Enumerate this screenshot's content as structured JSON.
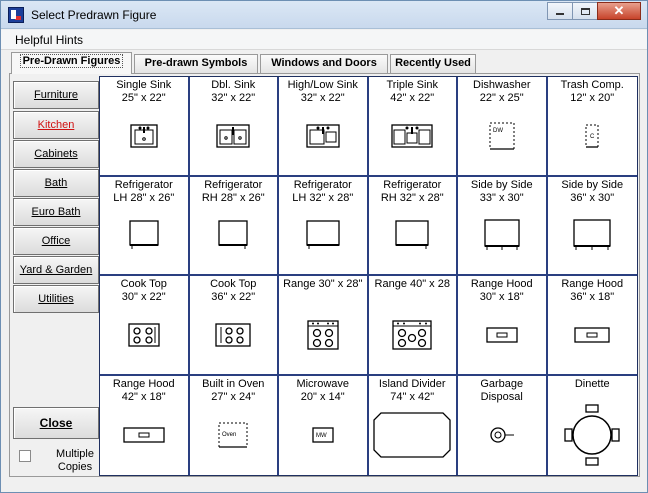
{
  "window": {
    "title": "Select Predrawn Figure",
    "controls": [
      "minimize",
      "maximize",
      "close"
    ]
  },
  "menu": {
    "helpful_hints": "Helpful Hints"
  },
  "tabs": [
    {
      "label": "Pre-Drawn Figures",
      "active": true
    },
    {
      "label": "Pre-drawn Symbols",
      "active": false
    },
    {
      "label": "Windows and Doors",
      "active": false
    },
    {
      "label": "Recently Used",
      "active": false
    }
  ],
  "sidebar": {
    "items": [
      {
        "label": "Furniture",
        "active": false
      },
      {
        "label": "Kitchen",
        "active": true
      },
      {
        "label": "Cabinets",
        "active": false
      },
      {
        "label": "Bath",
        "active": false
      },
      {
        "label": "Euro Bath",
        "active": false
      },
      {
        "label": "Office",
        "active": false
      },
      {
        "label": "Yard & Garden",
        "active": false
      },
      {
        "label": "Utilities",
        "active": false
      }
    ],
    "close_label": "Close",
    "multiple_copies_label": "Multiple Copies",
    "multiple_copies_checked": false
  },
  "figures": [
    {
      "name": "Single Sink",
      "size": "25\" x 22\"",
      "icon": "sink-single-icon"
    },
    {
      "name": "Dbl. Sink",
      "size": "32\" x 22\"",
      "icon": "sink-double-icon"
    },
    {
      "name": "High/Low Sink",
      "size": "32\" x 22\"",
      "icon": "sink-highlow-icon"
    },
    {
      "name": "Triple Sink",
      "size": "42\" x 22\"",
      "icon": "sink-triple-icon"
    },
    {
      "name": "Dishwasher",
      "size": "22\" x 25\"",
      "icon": "dishwasher-icon",
      "icon_text": "DW"
    },
    {
      "name": "Trash Comp.",
      "size": "12\" x 20\"",
      "icon": "trash-compactor-icon",
      "icon_text": "C"
    },
    {
      "name": "Refrigerator",
      "size": "LH 28\" x 26\"",
      "icon": "refrigerator-lh-28-icon"
    },
    {
      "name": "Refrigerator",
      "size": "RH 28\" x 26\"",
      "icon": "refrigerator-rh-28-icon"
    },
    {
      "name": "Refrigerator",
      "size": "LH 32\" x 28\"",
      "icon": "refrigerator-lh-32-icon"
    },
    {
      "name": "Refrigerator",
      "size": "RH 32\" x 28\"",
      "icon": "refrigerator-rh-32-icon"
    },
    {
      "name": "Side by Side",
      "size": "33\" x 30\"",
      "icon": "side-by-side-33-icon"
    },
    {
      "name": "Side by Side",
      "size": "36\" x 30\"",
      "icon": "side-by-side-36-icon"
    },
    {
      "name": "Cook Top",
      "size": "30\" x 22\"",
      "icon": "cooktop-30-icon"
    },
    {
      "name": "Cook Top",
      "size": "36\" x 22\"",
      "icon": "cooktop-36-icon"
    },
    {
      "name": "Range 30\" x 28\"",
      "size": "",
      "icon": "range-30-icon"
    },
    {
      "name": "Range 40\" x 28",
      "size": "",
      "icon": "range-40-icon"
    },
    {
      "name": "Range Hood",
      "size": "30\" x 18\"",
      "icon": "range-hood-30-icon"
    },
    {
      "name": "Range Hood",
      "size": "36\" x 18\"",
      "icon": "range-hood-36-icon"
    },
    {
      "name": "Range Hood",
      "size": "42\" x 18\"",
      "icon": "range-hood-42-icon"
    },
    {
      "name": "Built in Oven",
      "size": "27\" x 24\"",
      "icon": "built-in-oven-icon",
      "icon_text": "Oven"
    },
    {
      "name": "Microwave",
      "size": "20\" x 14\"",
      "icon": "microwave-icon",
      "icon_text": "MW"
    },
    {
      "name": "Island Divider",
      "size": "74\" x 42\"",
      "icon": "island-divider-icon"
    },
    {
      "name": "Garbage",
      "size": "Disposal",
      "icon": "garbage-disposal-icon"
    },
    {
      "name": "Dinette",
      "size": "",
      "icon": "dinette-icon"
    }
  ]
}
